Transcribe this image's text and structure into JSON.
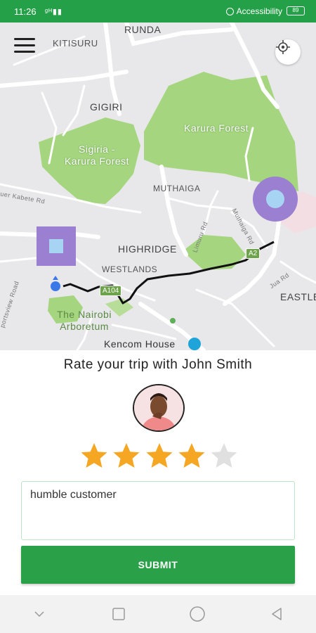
{
  "status_bar": {
    "time": "11:26",
    "signal": "ᵍᵀıll",
    "accessibility": "Accessibility",
    "battery": "89"
  },
  "map": {
    "labels": {
      "runda": "RUNDA",
      "kitisuru": "KITISURU",
      "gigiri": "GIGIRI",
      "karura_forest": "Karura Forest",
      "sigiria": "Sigiria -\nKarura Forest",
      "muthaiga": "MUTHAIGA",
      "highridge": "HIGHRIDGE",
      "westlands": "WESTLANDS",
      "eastleigh": "EASTLE",
      "nairobi_arboretum": "The Nairobi\nArboretum",
      "kencom_house": "Kencom House",
      "a104": "A104",
      "a2": "A2",
      "limuru_rd": "Limuru Rd",
      "muthaiga_rd": "Muthaiga Rd",
      "kabete_rd": "uer Kabete Rd",
      "sport_rd": "portsview Road",
      "jua_rd": "Jua Rd"
    },
    "colors": {
      "background": "#e8e8ea",
      "forest": "#a5d67f",
      "route": "#111111",
      "origin_marker": "#9b7fd0",
      "destination_marker": "#9b7fd0"
    }
  },
  "rating": {
    "title": "Rate your trip with John Smith",
    "stars_total": 5,
    "stars_filled": 4,
    "filled_color": "#f5a623",
    "empty_color": "#e0e0e0"
  },
  "feedback": {
    "value": "humble customer",
    "placeholder": ""
  },
  "submit": {
    "label": "SUBMIT"
  },
  "nav_bar": {
    "icons": [
      "chevron-down-icon",
      "recent-apps-icon",
      "home-icon",
      "back-icon"
    ]
  }
}
